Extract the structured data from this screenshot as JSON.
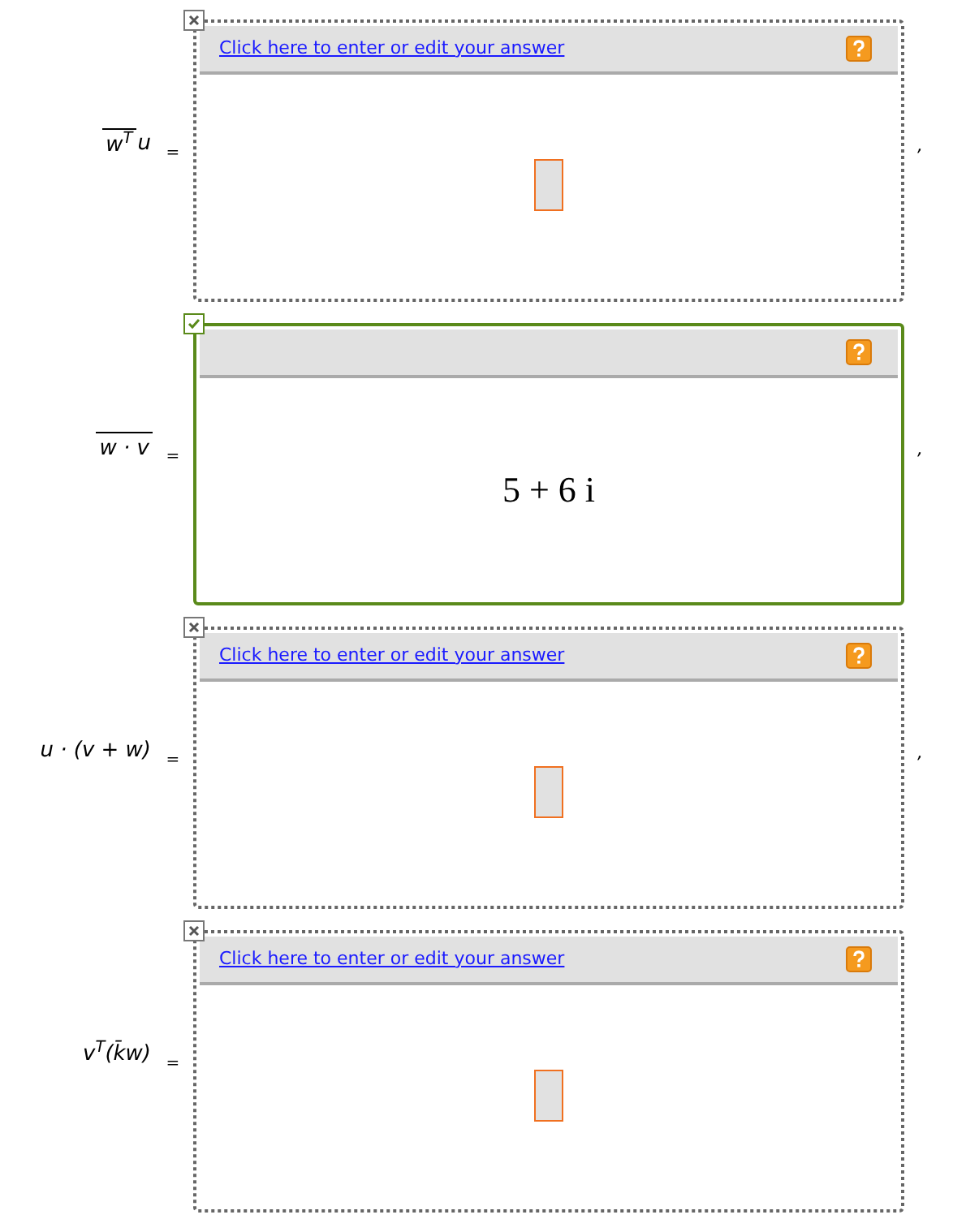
{
  "questions": [
    {
      "correct": false,
      "expression": [
        {
          "text": "w$^{T}$",
          "overline": true
        },
        {
          "text": "u",
          "overline": false
        }
      ],
      "equals": "=",
      "link": "Click here to enter or edit your answer",
      "comma": ","
    },
    {
      "correct": true,
      "expression": [
        {
          "text": "w · v",
          "overline": true
        }
      ],
      "equals": "=",
      "answer": "5 + 6 i",
      "comma": ","
    },
    {
      "correct": false,
      "expression": [
        {
          "text": "u · (v + w)",
          "overline": false
        }
      ],
      "equals": "=",
      "link": "Click here to enter or edit your answer",
      "comma": ","
    },
    {
      "correct": false,
      "expression": [
        {
          "text": "v$^{T}$(k̄w)",
          "overline": false
        }
      ],
      "equals": "=",
      "link": "Click here to enter or edit your answer"
    }
  ]
}
